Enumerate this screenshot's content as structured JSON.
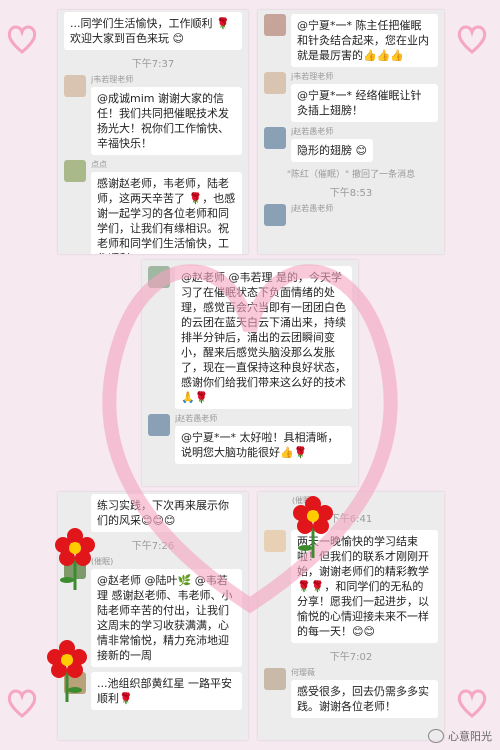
{
  "panel_tl": {
    "top_text": "...同学们生活愉快，工作顺利 🌹 欢迎大家到百色来玩 😊",
    "time1": "下午7:37",
    "msg1": {
      "sender": "j韦若理老师",
      "text": "@成诚mim 谢谢大家的信任！我们共同把催眠技术发扬光大！祝你们工作愉快、辛福快乐！"
    },
    "msg2": {
      "sender": "点点",
      "text": "感谢赵老师，韦老师，陆老师，这两天辛苦了 🌹，也感谢一起学习的各位老师和同学们，让我们有缘相识。祝老师和同学们生活愉快，工作顺利"
    }
  },
  "panel_tr": {
    "msg1": {
      "text": "@宁夏*一* 陈主任把催眠和针灸结合起来，您在业内就是最厉害的👍👍👍"
    },
    "msg2": {
      "sender": "j韦若理老师",
      "text": "@宁夏*一* 经络催眠让针灸插上翅膀！"
    },
    "msg3": {
      "sender": "j赵若愚老师",
      "text": "隐形的翅膀 😊"
    },
    "recall": "\"陈红（催眠）\" 撤回了一条消息",
    "time1": "下午8:53",
    "msg4": {
      "sender": "j赵若愚老师"
    }
  },
  "panel_center": {
    "msg1": {
      "text": "@赵老师 @韦若理 是的，今天学习了在催眠状态下负面情绪的处理，感觉百会穴当即有一团团白色的云团在蓝天白云下涌出来，持续排半分钟后，涌出的云团瞬间变小，醒来后感觉头脑没那么发胀了，现在一直保持这种良好状态，感谢你们给我们带来这么好的技术🙏🌹"
    },
    "msg2": {
      "sender": "j赵若愚老师",
      "text": "@宁夏*一* 太好啦！具相清晰，说明您大脑功能很好👍🌹"
    }
  },
  "panel_bl": {
    "top_text": "练习实践，下次再来展示你们的风采😊😊😊",
    "time1": "下午7:26",
    "msg1": {
      "sender": "(催眠)",
      "text": "@赵老师 @陆叶🌿 @韦若理 感谢赵老师、韦老师、小陆老师辛苦的付出，让我们这周末的学习收获满满，心情非常愉悦，精力充沛地迎接新的一周"
    },
    "msg2": {
      "text": "...池组织部黄红星 一路平安顺利🌹"
    }
  },
  "panel_br": {
    "sender0": "(催眠)",
    "time1": "下午6:41",
    "msg1": {
      "text": "两天一晚愉快的学习结束啦！但我们的联系才刚刚开始，谢谢老师们的精彩教学🌹🌹，和同学们的无私的分享！愿我们一起进步，以愉悦的心情迎接未来不一样的每一天！😊😊"
    },
    "time2": "下午7:02",
    "msg2": {
      "sender": "何璎薇",
      "text": "感受很多，回去仍需多多实践。谢谢各位老师！"
    }
  },
  "watermark": "心意阳光",
  "colors": {
    "heart": "#f5a3c0",
    "bg": "#f6e9f0",
    "panel": "#ececec",
    "flower": "#e0161b"
  }
}
